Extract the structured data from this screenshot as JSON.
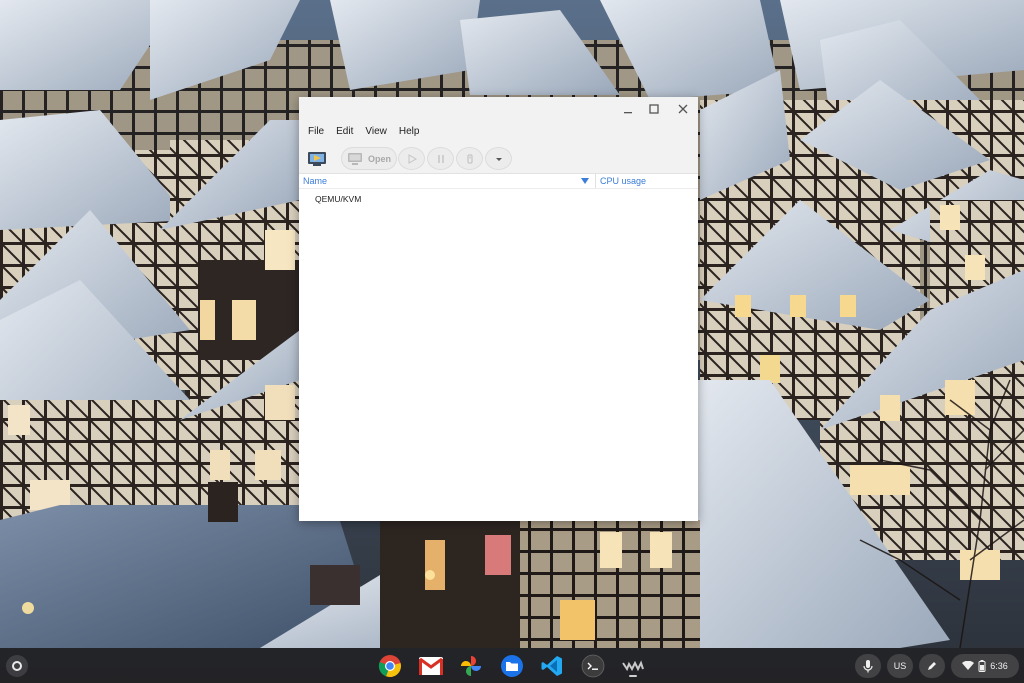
{
  "window": {
    "menu": [
      "File",
      "Edit",
      "View",
      "Help"
    ],
    "toolbar": {
      "open_label": "Open"
    },
    "columns": {
      "name": "Name",
      "cpu": "CPU usage"
    },
    "connections": [
      {
        "name": "QEMU/KVM"
      }
    ]
  },
  "shelf": {
    "apps": [
      "chrome-icon",
      "gmail-icon",
      "photos-icon",
      "files-icon",
      "vscode-icon",
      "terminal-icon",
      "virt-manager-icon"
    ],
    "ime_label": "US",
    "time": "6:36"
  },
  "colors": {
    "column_header": "#3b7dd8",
    "shelf": "#201e20",
    "accent_blue": "#2f6fd8"
  }
}
